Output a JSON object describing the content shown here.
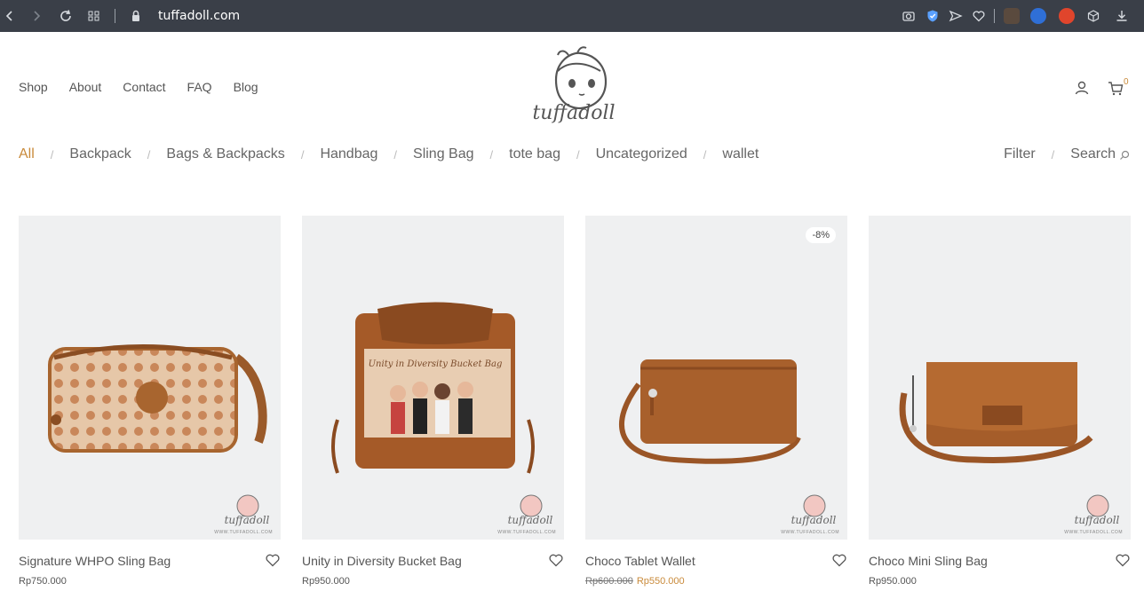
{
  "browser": {
    "url": "tuffadoll.com"
  },
  "header": {
    "nav": [
      "Shop",
      "About",
      "Contact",
      "FAQ",
      "Blog"
    ],
    "logo_text": "tuffadoll",
    "cart_count": "0"
  },
  "categories": {
    "items": [
      "All",
      "Backpack",
      "Bags & Backpacks",
      "Handbag",
      "Sling Bag",
      "tote bag",
      "Uncategorized",
      "wallet"
    ],
    "active": "All",
    "filter_label": "Filter",
    "search_label": "Search"
  },
  "products": [
    {
      "title": "Signature WHPO Sling Bag",
      "price": "Rp750.000",
      "old_price": "",
      "sale_price": "",
      "badge": ""
    },
    {
      "title": "Unity in Diversity Bucket Bag",
      "price": "Rp950.000",
      "old_price": "",
      "sale_price": "",
      "badge": ""
    },
    {
      "title": "Choco Tablet Wallet",
      "price": "",
      "old_price": "Rp600.000",
      "sale_price": "Rp550.000",
      "badge": "-8%"
    },
    {
      "title": "Choco Mini Sling Bag",
      "price": "Rp950.000",
      "old_price": "",
      "sale_price": "",
      "badge": ""
    }
  ],
  "watermark": {
    "brand": "tuffadoll",
    "site": "WWW.TUFFADOLL.COM"
  },
  "colors": {
    "accent": "#c98a3a",
    "browser_bar": "#3a3f48",
    "product_bg": "#eff0f1",
    "leather": "#9a5a2a"
  },
  "icons": {
    "nav_back": "chevron-left-icon",
    "nav_forward": "chevron-right-icon",
    "reload": "reload-icon",
    "tabs": "grid-icon",
    "lock": "lock-icon",
    "camera": "camera-icon",
    "shield": "shield-icon",
    "send": "send-icon",
    "heart": "heart-icon",
    "box": "cube-icon",
    "download": "download-icon",
    "account": "user-icon",
    "cart": "cart-icon",
    "wishlist": "heart-icon",
    "search": "search-icon"
  }
}
